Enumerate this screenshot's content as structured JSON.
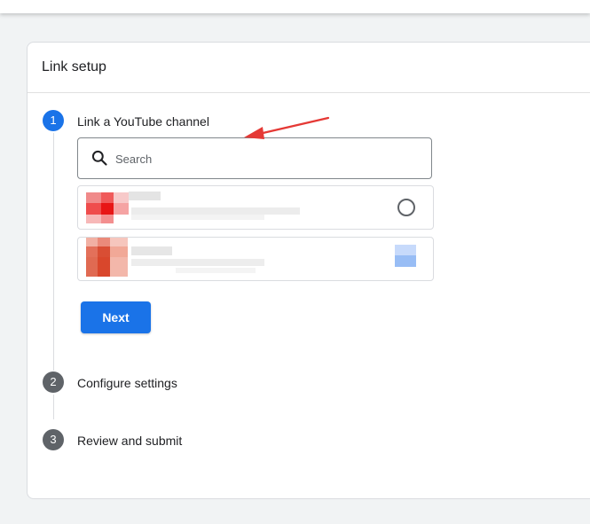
{
  "card": {
    "title": "Link setup"
  },
  "steps": [
    {
      "number": "1",
      "label": "Link a YouTube channel",
      "active": true
    },
    {
      "number": "2",
      "label": "Configure settings",
      "active": false
    },
    {
      "number": "3",
      "label": "Review and submit",
      "active": false
    }
  ],
  "search": {
    "placeholder": "Search",
    "icon": "search-icon"
  },
  "actions": {
    "next_label": "Next"
  },
  "colors": {
    "primary": "#1a73e8",
    "inactive_step": "#5f6368",
    "annotation_arrow": "#e53935"
  }
}
